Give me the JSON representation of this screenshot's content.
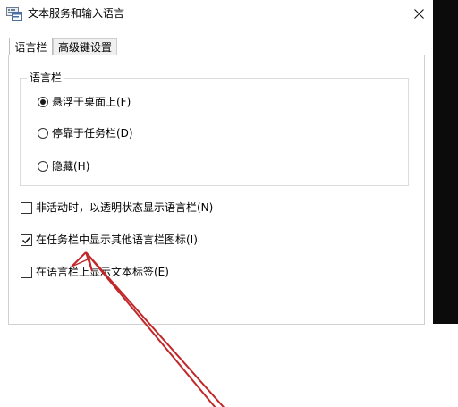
{
  "window": {
    "title": "文本服务和输入语言"
  },
  "tabs": [
    {
      "label": "语言栏",
      "active": true
    },
    {
      "label": "高级键设置",
      "active": false
    }
  ],
  "language_bar_group": {
    "legend": "语言栏",
    "options": [
      {
        "label": "悬浮于桌面上(F)",
        "selected": true
      },
      {
        "label": "停靠于任务栏(D)",
        "selected": false
      },
      {
        "label": "隐藏(H)",
        "selected": false
      }
    ]
  },
  "checkboxes": [
    {
      "label": "非活动时，以透明状态显示语言栏(N)",
      "checked": false
    },
    {
      "label": "在任务栏中显示其他语言栏图标(I)",
      "checked": true
    },
    {
      "label": "在语言栏上显示文本标签(E)",
      "checked": false
    }
  ],
  "colors": {
    "annotation_arrow": "#c0282a"
  },
  "icons": {
    "app": "keyboard-icon",
    "close": "close-icon",
    "check": "checkmark-icon"
  }
}
